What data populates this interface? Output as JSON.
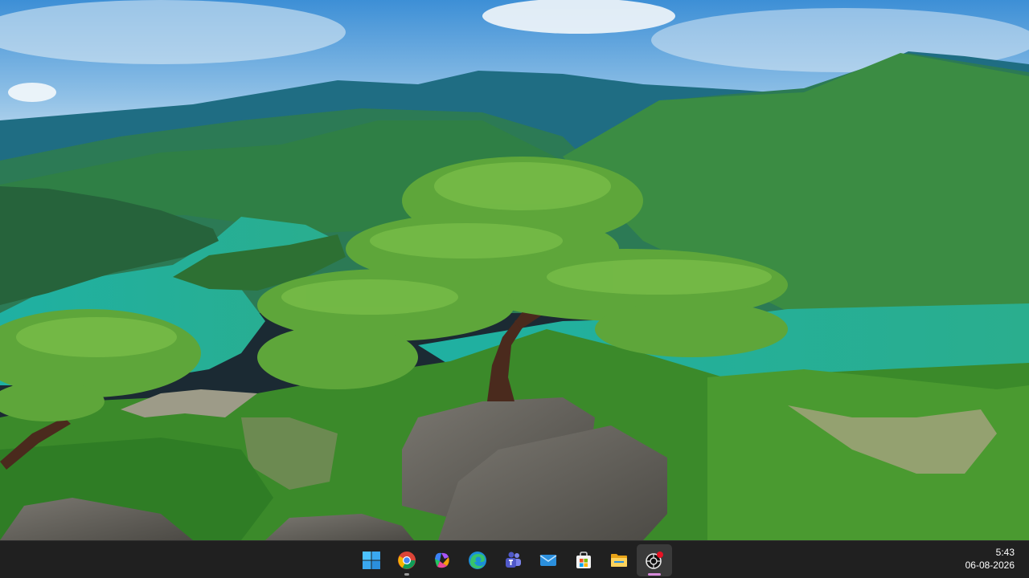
{
  "desktop": {
    "wallpaper": "mountain-lake-pine-tree-landscape"
  },
  "taskbar": {
    "apps": [
      {
        "id": "start",
        "icon": "windows-start-icon",
        "running": false
      },
      {
        "id": "chrome",
        "icon": "chrome-icon",
        "running": true
      },
      {
        "id": "copilot",
        "icon": "copilot-icon",
        "running": false
      },
      {
        "id": "edge",
        "icon": "edge-icon",
        "running": false
      },
      {
        "id": "teams",
        "icon": "teams-icon",
        "running": false
      },
      {
        "id": "mail",
        "icon": "mail-icon",
        "running": false
      },
      {
        "id": "store",
        "icon": "microsoft-store-icon",
        "running": false
      },
      {
        "id": "explorer",
        "icon": "file-explorer-icon",
        "running": false
      },
      {
        "id": "recorder",
        "icon": "screen-recorder-icon",
        "running": true,
        "active": true
      }
    ],
    "clock": {
      "time": "5:43",
      "date": "06-08-2026"
    },
    "colors": {
      "background": "#202020",
      "active_indicator": "#d58ad8"
    }
  }
}
